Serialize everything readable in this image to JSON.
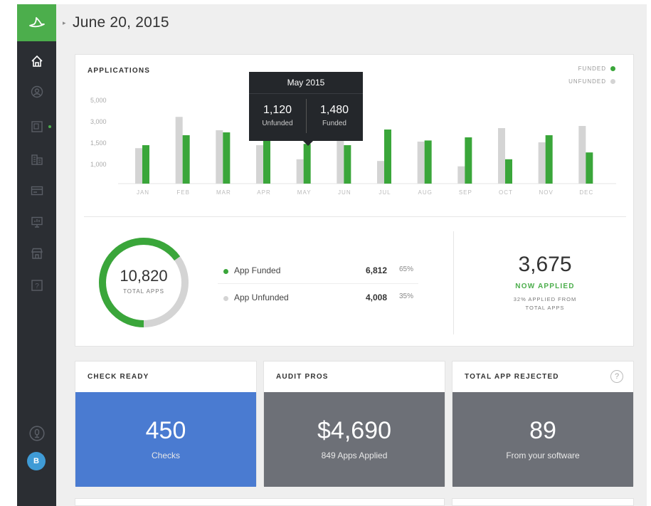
{
  "header": {
    "date": "June 20, 2015"
  },
  "sidebar": {
    "items": [
      {
        "icon": "home-icon",
        "active": true
      },
      {
        "icon": "user-circle-icon",
        "active": false
      },
      {
        "icon": "document-icon",
        "active": false,
        "indicator": true
      },
      {
        "icon": "building-icon",
        "active": false
      },
      {
        "icon": "card-icon",
        "active": false
      },
      {
        "icon": "monitor-icon",
        "active": false
      },
      {
        "icon": "store-icon",
        "active": false
      },
      {
        "icon": "help-icon",
        "active": false
      }
    ],
    "bottom": {
      "icon": "support-icon",
      "avatar_initial": "B"
    }
  },
  "applications": {
    "title": "APPLICATIONS",
    "legend": {
      "funded": "FUNDED",
      "unfunded": "UNFUNDED"
    },
    "tooltip": {
      "title": "May 2015",
      "unfunded_value": "1,120",
      "unfunded_label": "Unfunded",
      "funded_value": "1,480",
      "funded_label": "Funded"
    }
  },
  "chart_data": {
    "type": "bar",
    "categories": [
      "JAN",
      "FEB",
      "MAR",
      "APR",
      "MAY",
      "JUN",
      "JUL",
      "AUG",
      "SEP",
      "OCT",
      "NOV",
      "DEC"
    ],
    "y_ticks": [
      "5,000",
      "3,000",
      "1,500",
      "1,000"
    ],
    "y_tick_values": [
      5000,
      3000,
      1500,
      1000
    ],
    "series": [
      {
        "name": "UNFUNDED",
        "color": "#d4d4d4",
        "values": [
          1380,
          3450,
          2400,
          1450,
          1120,
          2000,
          1080,
          1600,
          900,
          2550,
          1550,
          2700
        ]
      },
      {
        "name": "FUNDED",
        "color": "#3aa63a",
        "values": [
          1450,
          2050,
          2250,
          2000,
          1480,
          1450,
          2450,
          1680,
          1900,
          1120,
          2050,
          1280
        ]
      }
    ]
  },
  "summary": {
    "total_apps": "10,820",
    "total_label": "TOTAL APPS",
    "funded_fraction": 0.65,
    "rows": [
      {
        "label": "App Funded",
        "value": "6,812",
        "percent": "65%",
        "color": "#3aa63a"
      },
      {
        "label": "App Unfunded",
        "value": "4,008",
        "percent": "35%",
        "color": "#d4d4d4"
      }
    ],
    "applied_number": "3,675",
    "applied_label": "NOW APPLIED",
    "applied_sub_1": "32% APPLIED FROM",
    "applied_sub_2": "TOTAL APPS"
  },
  "tiles": [
    {
      "title": "CHECK READY",
      "value": "450",
      "subtitle": "Checks",
      "color": "#4a7bd1"
    },
    {
      "title": "AUDIT PROS",
      "value": "$4,690",
      "subtitle": "849 Apps Applied",
      "color": "#6d7077"
    },
    {
      "title": "TOTAL APP REJECTED",
      "value": "89",
      "subtitle": "From your software",
      "color": "#6d7077",
      "help": "?"
    }
  ]
}
